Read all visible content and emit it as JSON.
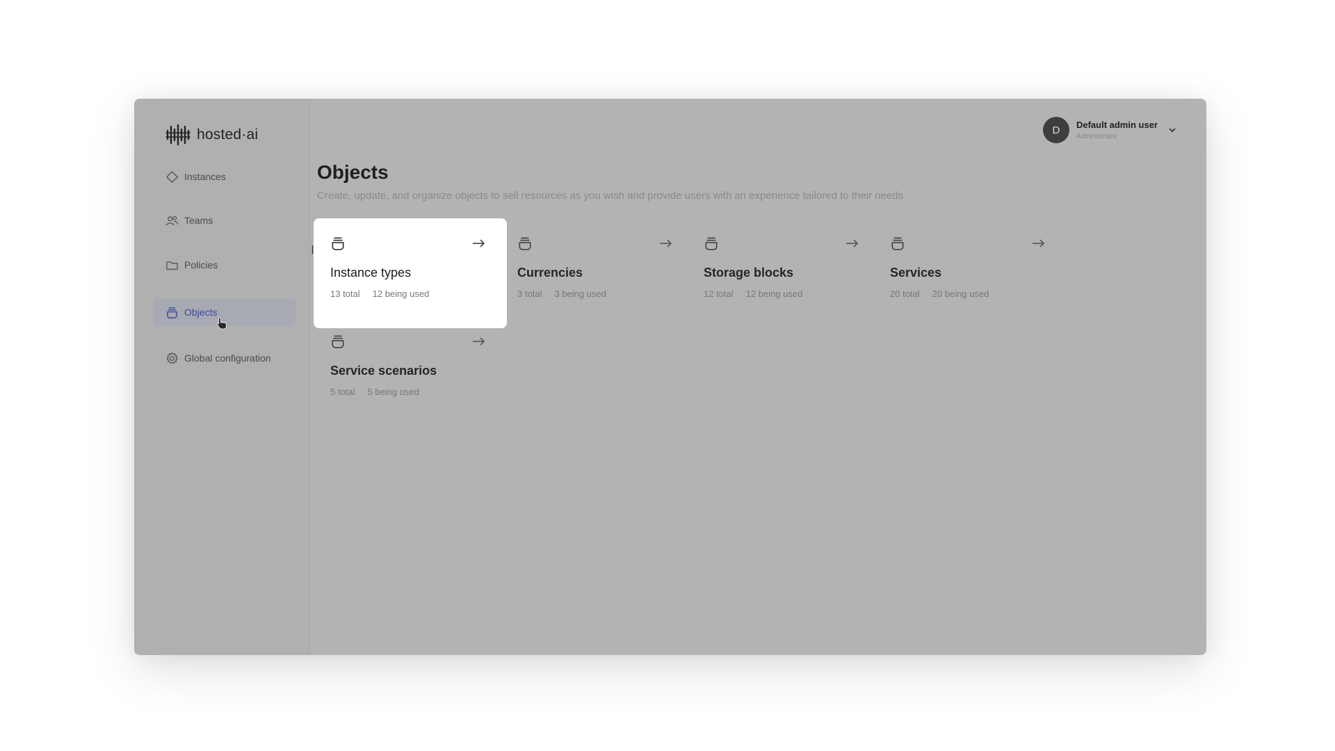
{
  "brand": {
    "name": "hosted·ai"
  },
  "sidebar": {
    "items": [
      {
        "label": "Instances",
        "icon": "diamond-icon",
        "active": false
      },
      {
        "label": "Teams",
        "icon": "users-icon",
        "active": false
      },
      {
        "label": "Policies",
        "icon": "folder-icon",
        "active": false
      },
      {
        "label": "Objects",
        "icon": "objects-icon",
        "active": true
      },
      {
        "label": "Global configuration",
        "icon": "gear-icon",
        "active": false
      }
    ]
  },
  "user": {
    "initial": "D",
    "name": "Default admin user",
    "role": "Administrator"
  },
  "page": {
    "title": "Objects",
    "subtitle": "Create, update, and organize objects to sell resources as you wish and provide users with an experience tailored to their needs"
  },
  "cards": [
    {
      "title": "Instance types",
      "total": "13 total",
      "used": "12 being used",
      "highlighted": true
    },
    {
      "title": "Currencies",
      "total": "3 total",
      "used": "3 being used",
      "highlighted": false
    },
    {
      "title": "Storage blocks",
      "total": "12 total",
      "used": "12 being used",
      "highlighted": false
    },
    {
      "title": "Services",
      "total": "20 total",
      "used": "20 being used",
      "highlighted": false
    },
    {
      "title": "Service scenarios",
      "total": "5 total",
      "used": "5 being used",
      "highlighted": false
    }
  ],
  "colors": {
    "overlay": "#b3b3b3",
    "active_nav_bg": "#a7a9b3",
    "active_nav_text": "#3a4a9a",
    "card_highlight": "#ffffff"
  }
}
